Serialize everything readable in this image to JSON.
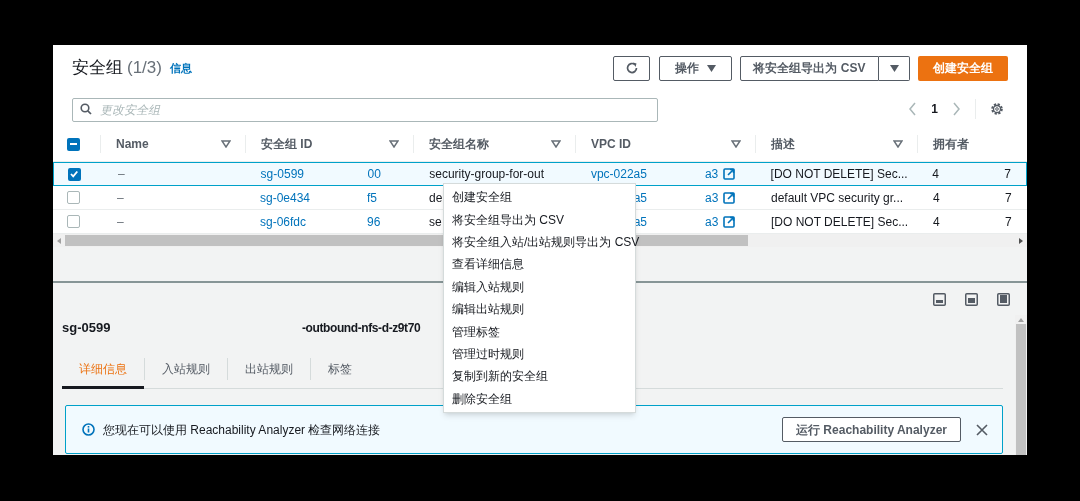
{
  "header": {
    "title": "安全组",
    "count": "(1/3)",
    "info_link": "信息"
  },
  "toolbar": {
    "actions": "操作",
    "export": "将安全组导出为 CSV",
    "create": "创建安全组"
  },
  "search": {
    "placeholder": "更改安全组"
  },
  "pagination": {
    "page": "1"
  },
  "table": {
    "select_all_partial": true,
    "columns": [
      "Name",
      "安全组 ID",
      "安全组名称",
      "VPC ID",
      "描述",
      "拥有者"
    ],
    "rows": [
      {
        "selected": true,
        "name": "–",
        "id_start": "sg-0599",
        "id_end": "00",
        "group_name": "security-group-for-out",
        "vpc_start": "vpc-022a5",
        "vpc_end": "a3",
        "description": "[DO NOT DELETE] Sec...",
        "owner_start": "4",
        "owner_end": "7"
      },
      {
        "selected": false,
        "name": "–",
        "id_start": "sg-0e434",
        "id_end": "f5",
        "group_name": "de",
        "vpc_start": "a5",
        "vpc_end": "a3",
        "description": "default VPC security gr...",
        "owner_start": "4",
        "owner_end": "7"
      },
      {
        "selected": false,
        "name": "–",
        "id_start": "sg-06fdc",
        "id_end": "96",
        "group_name": "se",
        "vpc_start": "a5",
        "vpc_end": "a3",
        "description": "[DO NOT DELETE] Sec...",
        "owner_start": "4",
        "owner_end": "7"
      }
    ]
  },
  "context_menu": {
    "items": [
      "创建安全组",
      "将安全组导出为 CSV",
      "将安全组入站/出站规则导出为 CSV",
      "查看详细信息",
      "编辑入站规则",
      "编辑出站规则",
      "管理标签",
      "管理过时规则",
      "复制到新的安全组",
      "删除安全组"
    ]
  },
  "details": {
    "id_start": "sg-0599",
    "name_end": "-outbound-nfs-d-z9t70",
    "tabs": [
      {
        "label": "详细信息",
        "selected": true
      },
      {
        "label": "入站规则",
        "selected": false
      },
      {
        "label": "出站规则",
        "selected": false
      },
      {
        "label": "标签",
        "selected": false
      }
    ]
  },
  "banner": {
    "message": "您现在可以使用 Reachability Analyzer 检查网络连接",
    "button": "运行 Reachability Analyzer"
  }
}
